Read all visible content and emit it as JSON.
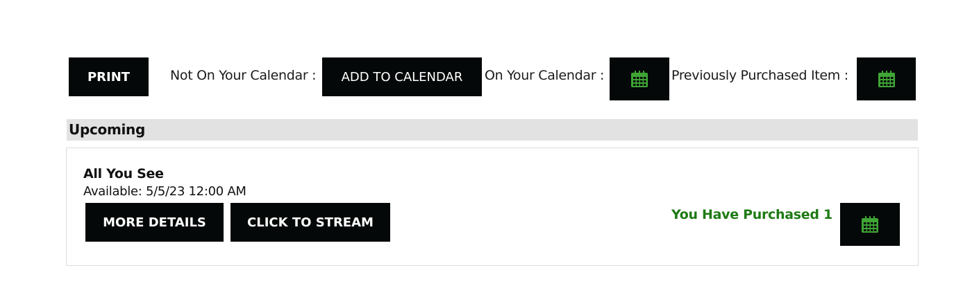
{
  "toolbar": {
    "print_label": "PRINT",
    "not_on_calendar_label": "Not On Your Calendar :",
    "add_to_calendar_label": "ADD TO CALENDAR",
    "on_calendar_label": "On Your Calendar :",
    "on_calendar_icon": "calendar-icon",
    "previously_purchased_label": "Previously Purchased Item :",
    "previously_purchased_icon": "calendar-icon"
  },
  "section": {
    "title": "Upcoming"
  },
  "event": {
    "title": "All You See",
    "availability": "Available: 5/5/23 12:00 AM",
    "more_details_label": "MORE DETAILS",
    "stream_label": "CLICK TO STREAM",
    "purchased_text": "You Have Purchased 1",
    "purchased_icon": "calendar-icon"
  },
  "colors": {
    "button_bg": "#050808",
    "button_text": "#ffffff",
    "icon_green": "#3fa535",
    "purchased_green": "#1e7a14",
    "section_bar": "#e2e2e2"
  }
}
